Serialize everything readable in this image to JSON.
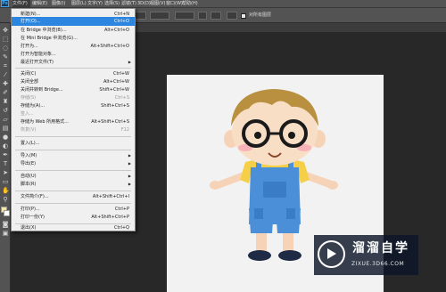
{
  "menubar": {
    "logo": "Ps",
    "items": [
      "文件(F)",
      "编辑(E)",
      "图像(I)",
      "图层(L)",
      "文字(Y)",
      "选择(S)",
      "滤镜(T)",
      "3D(D)",
      "视图(V)",
      "窗口(W)",
      "帮助(H)"
    ]
  },
  "optionsbar": {
    "sample_checkbox_label": "对所有图层"
  },
  "file_menu": {
    "new": {
      "label": "新建(N)...",
      "shortcut": "Ctrl+N"
    },
    "open": {
      "label": "打开(O)...",
      "shortcut": "Ctrl+O"
    },
    "browse_bridge": {
      "label": "在 Bridge 中浏览(B)...",
      "shortcut": "Alt+Ctrl+O"
    },
    "browse_mini_bridge": {
      "label": "在 Mini Bridge 中浏览(G)..."
    },
    "open_as": {
      "label": "打开为...",
      "shortcut": "Alt+Shift+Ctrl+O"
    },
    "open_smart_object": {
      "label": "打开为智能对象..."
    },
    "recent_files": {
      "label": "最近打开文件(T)"
    },
    "close": {
      "label": "关闭(C)",
      "shortcut": "Ctrl+W"
    },
    "close_all": {
      "label": "关闭全部",
      "shortcut": "Alt+Ctrl+W"
    },
    "close_go_bridge": {
      "label": "关闭并转到 Bridge...",
      "shortcut": "Shift+Ctrl+W"
    },
    "save": {
      "label": "存储(S)",
      "shortcut": "Ctrl+S"
    },
    "save_as": {
      "label": "存储为(A)...",
      "shortcut": "Shift+Ctrl+S"
    },
    "check_in": {
      "label": "签入..."
    },
    "save_for_web": {
      "label": "存储为 Web 所用格式...",
      "shortcut": "Alt+Shift+Ctrl+S"
    },
    "revert": {
      "label": "恢复(V)",
      "shortcut": "F12"
    },
    "place": {
      "label": "置入(L)..."
    },
    "import": {
      "label": "导入(M)"
    },
    "export": {
      "label": "导出(E)"
    },
    "automate": {
      "label": "自动(U)"
    },
    "scripts": {
      "label": "脚本(R)"
    },
    "file_info": {
      "label": "文件简介(F)...",
      "shortcut": "Alt+Shift+Ctrl+I"
    },
    "print": {
      "label": "打印(P)...",
      "shortcut": "Ctrl+P"
    },
    "print_one": {
      "label": "打印一份(Y)",
      "shortcut": "Alt+Shift+Ctrl+P"
    },
    "exit": {
      "label": "退出(X)",
      "shortcut": "Ctrl+Q"
    }
  },
  "watermark": {
    "title": "溜溜自学",
    "url": "ZIXUE.3D66.COM"
  },
  "colors": {
    "highlight": "#2c86e0",
    "ui_panel": "#535353",
    "workspace": "#282828"
  }
}
